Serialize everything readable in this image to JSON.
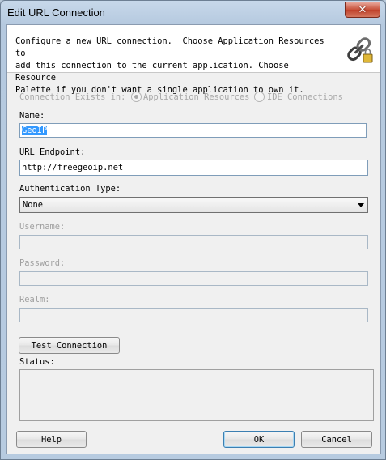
{
  "window": {
    "title": "Edit URL Connection",
    "close_glyph": "✕"
  },
  "banner": {
    "text": "Configure a new URL connection.  Choose Application Resources to\nadd this connection to the current application. Choose Resource\nPalette if you don't want a single application to own it.",
    "icon": "chain-link-icon"
  },
  "connection_exists": {
    "label": "Connection Exists in:",
    "options": [
      {
        "label": "Application Resources",
        "selected": true
      },
      {
        "label": "IDE Connections",
        "selected": false
      }
    ]
  },
  "fields": {
    "name": {
      "label": "Name:",
      "value": "GeoIP"
    },
    "url_endpoint": {
      "label": "URL Endpoint:",
      "value": "http://freegeoip.net"
    },
    "authentication_type": {
      "label": "Authentication Type:",
      "value": "None"
    },
    "username": {
      "label": "Username:",
      "value": ""
    },
    "password": {
      "label": "Password:",
      "value": ""
    },
    "realm": {
      "label": "Realm:",
      "value": ""
    }
  },
  "buttons": {
    "test_connection": "Test Connection",
    "help": "Help",
    "ok": "OK",
    "cancel": "Cancel"
  },
  "status": {
    "label": "Status:",
    "value": ""
  },
  "colors": {
    "selection": "#3399ff",
    "frame": "#b9c9da",
    "close_button": "#c75039"
  }
}
